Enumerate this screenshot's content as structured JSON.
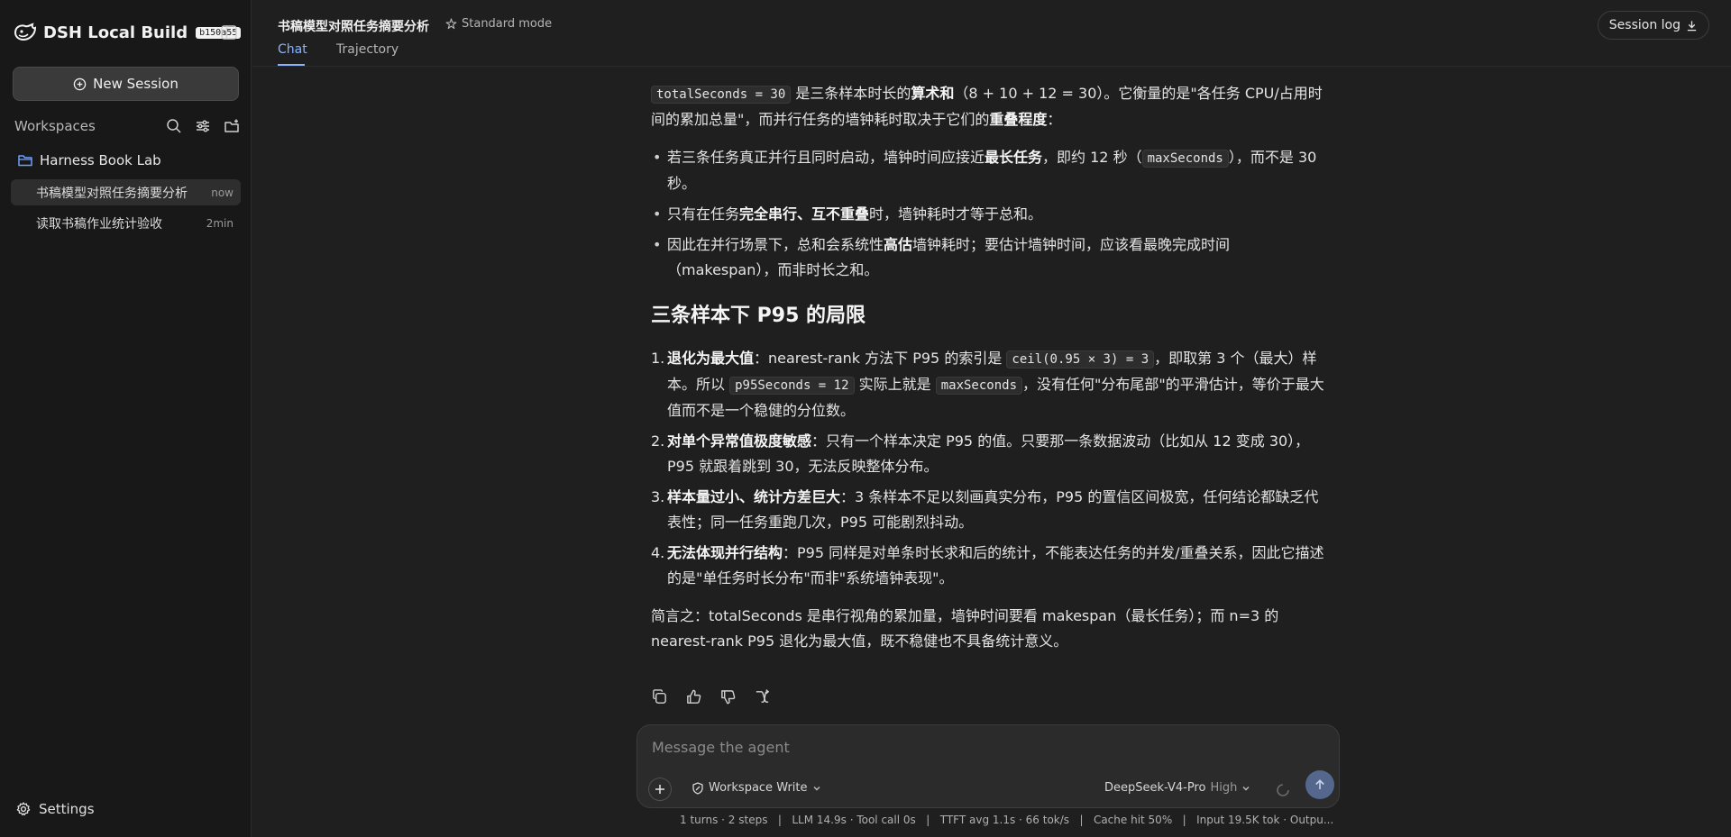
{
  "sidebar": {
    "brand_title": "DSH Local Build",
    "brand_badge": "b150a55",
    "new_session_label": "New Session",
    "workspaces_label": "Workspaces",
    "workspace_name": "Harness Book Lab",
    "sessions": [
      {
        "title": "书稿模型对照任务摘要分析",
        "time": "now",
        "active": true
      },
      {
        "title": "读取书稿作业统计验收",
        "time": "2min",
        "active": false
      }
    ],
    "settings_label": "Settings"
  },
  "header": {
    "title": "书稿模型对照任务摘要分析",
    "mode": "Standard mode",
    "tabs": [
      "Chat",
      "Trajectory"
    ],
    "session_log_label": "Session log"
  },
  "message": {
    "p1": {
      "code1": "totalSeconds = 30",
      "t1": " 是三条样本时长的",
      "b1": "算术和",
      "t2": "（8 + 10 + 12 = 30）。它衡量的是\"各任务 CPU/占用时间的累加总量\"，而并行任务的墙钟耗时取决于它们的",
      "b2": "重叠程度",
      "t3": "："
    },
    "bullets": {
      "b1": {
        "t1": "若三条任务真正并行且同时启动，墙钟时间应接近",
        "b1": "最长任务",
        "t2": "，即约 12 秒（",
        "code": "maxSeconds",
        "t3": "），而不是 30 秒。"
      },
      "b2": {
        "t1": "只有在任务",
        "b1": "完全串行、互不重叠",
        "t2": "时，墙钟耗时才等于总和。"
      },
      "b3": {
        "t1": "因此在并行场景下，总和会系统性",
        "b1": "高估",
        "t2": "墙钟耗时；要估计墙钟时间，应该看最晚完成时间（makespan），而非时长之和。"
      }
    },
    "heading": "三条样本下 P95 的局限",
    "numbered": {
      "n1": {
        "num": "1.",
        "b": "退化为最大值",
        "t1": "：nearest-rank 方法下 P95 的索引是 ",
        "c1": "ceil(0.95 × 3) = 3",
        "t2": "，即取第 3 个（最大）样本。所以 ",
        "c2": "p95Seconds = 12",
        "t3": " 实际上就是 ",
        "c3": "maxSeconds",
        "t4": "，没有任何\"分布尾部\"的平滑估计，等价于最大值而不是一个稳健的分位数。"
      },
      "n2": {
        "num": "2.",
        "b": "对单个异常值极度敏感",
        "t": "：只有一个样本决定 P95 的值。只要那一条数据波动（比如从 12 变成 30），P95 就跟着跳到 30，无法反映整体分布。"
      },
      "n3": {
        "num": "3.",
        "b": "样本量过小、统计方差巨大",
        "t": "：3 条样本不足以刻画真实分布，P95 的置信区间极宽，任何结论都缺乏代表性；同一任务重跑几次，P95 可能剧烈抖动。"
      },
      "n4": {
        "num": "4.",
        "b": "无法体现并行结构",
        "t": "：P95 同样是对单条时长求和后的统计，不能表达任务的并发/重叠关系，因此它描述的是\"单任务时长分布\"而非\"系统墙钟表现\"。"
      }
    },
    "summary": "简言之：totalSeconds 是串行视角的累加量，墙钟时间要看 makespan（最长任务）；而 n=3 的 nearest-rank P95 退化为最大值，既不稳健也不具备统计意义。"
  },
  "composer": {
    "placeholder": "Message the agent",
    "permission": "Workspace Write",
    "model": "DeepSeek-V4-Pro",
    "effort": "High"
  },
  "stats": "1 turns · 2 steps   |   LLM 14.9s · Tool call 0s   |   TTFT avg 1.1s · 66 tok/s   |   Cache hit 50%   |   Input 19.5K tok · Outpu...",
  "colors": {
    "background": "#1f1f1f",
    "sidebar": "#181818",
    "accent": "#8ab4ff",
    "send_button": "#56678e"
  }
}
